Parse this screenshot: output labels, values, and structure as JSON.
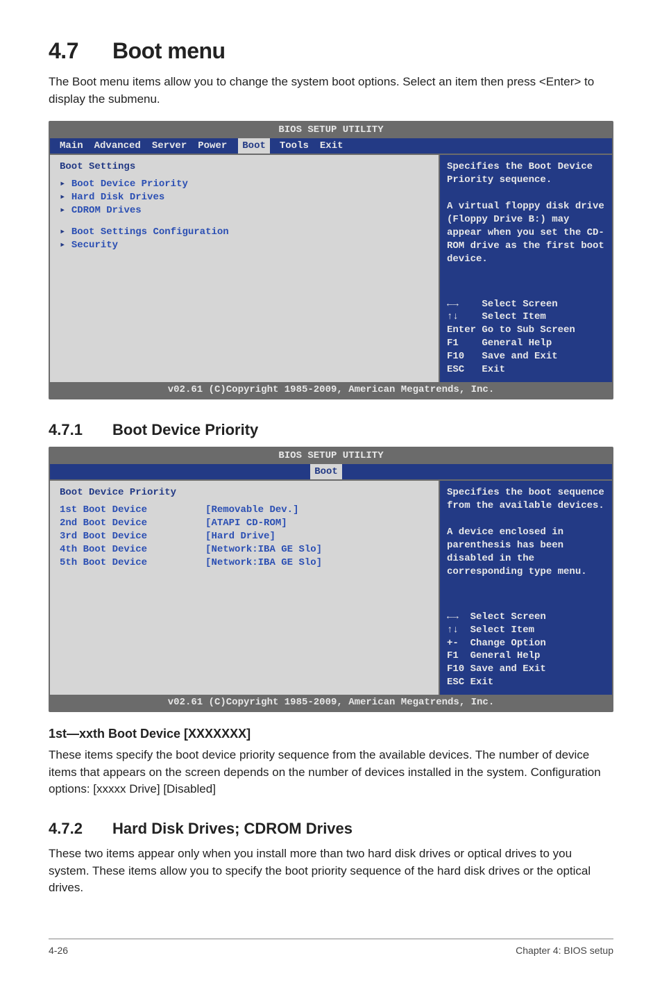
{
  "section": {
    "number": "4.7",
    "title": "Boot menu"
  },
  "intro": "The Boot menu items allow you to change the system boot options. Select an item then press <Enter> to display the submenu.",
  "sub1": {
    "number": "4.7.1",
    "title": "Boot Device Priority"
  },
  "sub2": {
    "number": "4.7.2",
    "title": "Hard Disk Drives; CDROM Drives"
  },
  "field_heading": "1st—xxth Boot Device [XXXXXXX]",
  "field_body": "These items specify the boot device priority sequence from the available devices. The number of device items that appears on the screen depends on the number of devices installed in the system. Configuration options: [xxxxx Drive] [Disabled]",
  "sub2_body": "These two items appear only when you install more than two hard disk drives or optical drives to you system. These items allow you to specify the boot priority sequence of the hard disk drives or the optical drives.",
  "bios1": {
    "utility_title": "BIOS SETUP UTILITY",
    "tabs": [
      "Main",
      "Advanced",
      "Server",
      "Power",
      "Boot",
      "Tools",
      "Exit"
    ],
    "selected_tab": "Boot",
    "left_title": "Boot Settings",
    "items": [
      "Boot Device Priority",
      "Hard Disk Drives",
      "CDROM Drives",
      "Boot Settings Configuration",
      "Security"
    ],
    "help": "Specifies the Boot Device Priority sequence.\n\nA virtual floppy disk drive (Floppy Drive B:) may appear when you set the CD-ROM drive as the first boot device.",
    "nav": [
      "←→    Select Screen",
      "↑↓    Select Item",
      "Enter Go to Sub Screen",
      "F1    General Help",
      "F10   Save and Exit",
      "ESC   Exit"
    ],
    "footer": "v02.61 (C)Copyright 1985-2009, American Megatrends, Inc."
  },
  "bios2": {
    "utility_title": "BIOS SETUP UTILITY",
    "selected_tab": "Boot",
    "left_title": "Boot Device Priority",
    "rows": [
      {
        "label": "1st Boot Device",
        "value": "[Removable Dev.]"
      },
      {
        "label": "2nd Boot Device",
        "value": "[ATAPI CD-ROM]"
      },
      {
        "label": "3rd Boot Device",
        "value": "[Hard Drive]"
      },
      {
        "label": "4th Boot Device",
        "value": "[Network:IBA GE Slo]"
      },
      {
        "label": "5th Boot Device",
        "value": "[Network:IBA GE Slo]"
      }
    ],
    "help": "Specifies the boot sequence from the available devices.\n\nA device enclosed in parenthesis has been disabled in the corresponding type menu.",
    "nav": [
      "←→  Select Screen",
      "↑↓  Select Item",
      "+-  Change Option",
      "F1  General Help",
      "F10 Save and Exit",
      "ESC Exit"
    ],
    "footer": "v02.61 (C)Copyright 1985-2009, American Megatrends, Inc."
  },
  "page_footer_left": "4-26",
  "page_footer_right": "Chapter 4: BIOS setup"
}
